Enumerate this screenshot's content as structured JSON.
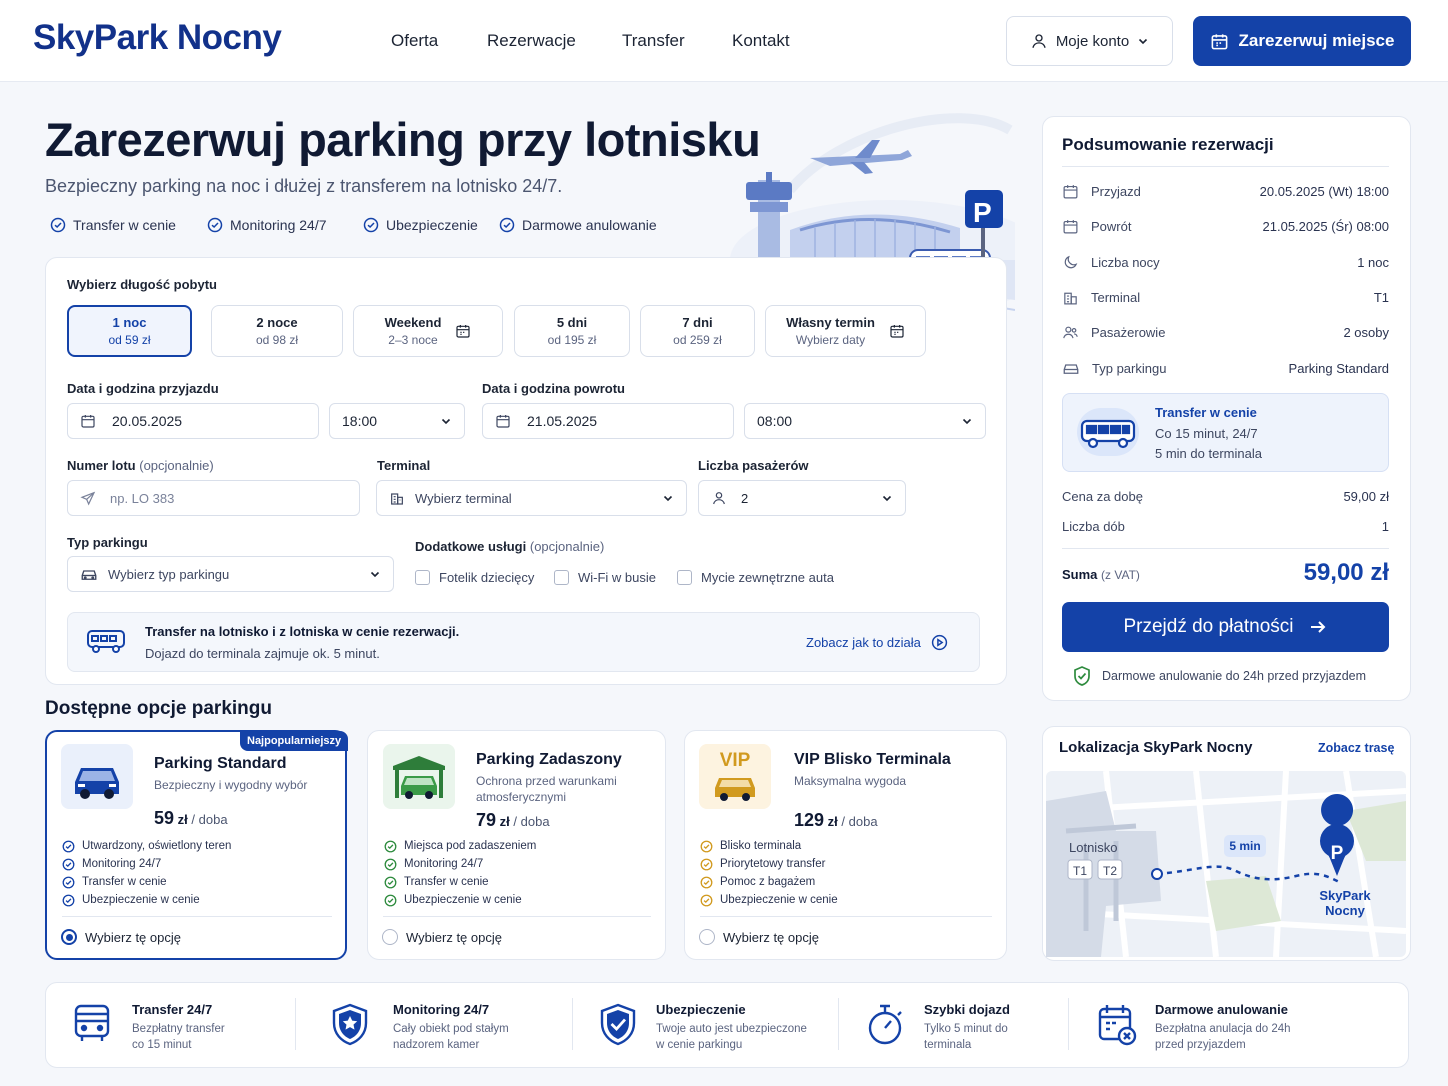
{
  "header": {
    "logo": "SkyPark Nocny",
    "nav": [
      "Oferta",
      "Rezerwacje",
      "Transfer",
      "Kontakt"
    ],
    "account_label": "Moje konto",
    "reserve_button": "Zarezerwuj miejsce"
  },
  "hero": {
    "title": "Zarezerwuj parking przy lotnisku",
    "subtitle": "Bezpieczny parking na noc i dłużej z transferem na lotnisko 24/7.",
    "features": [
      "Transfer w cenie",
      "Monitoring 24/7",
      "Ubezpieczenie",
      "Darmowe anulowanie"
    ],
    "parking_sign": "P"
  },
  "form": {
    "stay_label": "Wybierz długość pobytu",
    "stay_options": [
      {
        "title": "1 noc",
        "sub": "od 59 zł"
      },
      {
        "title": "2 noce",
        "sub": "od 98 zł"
      },
      {
        "title": "Weekend",
        "sub": "2–3 noce"
      },
      {
        "title": "5 dni",
        "sub": "od 195 zł"
      },
      {
        "title": "7 dni",
        "sub": "od 259 zł"
      },
      {
        "title": "Własny termin",
        "sub": "Wybierz daty"
      }
    ],
    "arrival_label": "Data i godzina przyjazdu",
    "arrival_date": "20.05.2025",
    "arrival_time": "18:00",
    "return_label": "Data i godzina powrotu",
    "return_date": "21.05.2025",
    "return_time": "08:00",
    "flight_label": "Numer lotu",
    "optional": "(opcjonalnie)",
    "flight_placeholder": "np. LO 383",
    "terminal_label": "Terminal",
    "terminal_placeholder": "Wybierz terminal",
    "passengers_label": "Liczba pasażerów",
    "passengers_value": "2",
    "parking_type_label": "Typ parkingu",
    "parking_type_placeholder": "Wybierz typ parkingu",
    "extras_label": "Dodatkowe usługi",
    "extras": [
      "Fotelik dziecięcy",
      "Wi-Fi w busie",
      "Mycie zewnętrzne auta"
    ],
    "transfer_title": "Transfer na lotnisko i z lotniska w cenie rezerwacji.",
    "transfer_sub": "Dojazd do terminala zajmuje ok. 5 minut.",
    "transfer_link": "Zobacz jak to działa"
  },
  "options": {
    "title": "Dostępne opcje parkingu",
    "cards": [
      {
        "badge": "Najpopularniejszy",
        "title": "Parking Standard",
        "sub": "Bezpieczny i wygodny wybór",
        "price": "59",
        "currency": "zł",
        "unit": "/ doba",
        "bullets": [
          "Utwardzony, oświetlony teren",
          "Monitoring 24/7",
          "Transfer w cenie",
          "Ubezpieczenie w cenie"
        ],
        "select": "Wybierz tę opcję"
      },
      {
        "title": "Parking Zadaszony",
        "sub": "Ochrona przed warunkami atmosferycznymi",
        "price": "79",
        "currency": "zł",
        "unit": "/ doba",
        "bullets": [
          "Miejsca pod zadaszeniem",
          "Monitoring 24/7",
          "Transfer w cenie",
          "Ubezpieczenie w cenie"
        ],
        "select": "Wybierz tę opcję"
      },
      {
        "icon_text": "VIP",
        "title": "VIP Blisko Terminala",
        "sub": "Maksymalna wygoda",
        "price": "129",
        "currency": "zł",
        "unit": "/ doba",
        "bullets": [
          "Blisko terminala",
          "Priorytetowy transfer",
          "Pomoc z bagażem",
          "Ubezpieczenie w cenie"
        ],
        "select": "Wybierz tę opcję"
      }
    ]
  },
  "summary": {
    "title": "Podsumowanie rezerwacji",
    "rows": [
      {
        "icon": "calendar-icon",
        "label": "Przyjazd",
        "value": "20.05.2025 (Wt) 18:00"
      },
      {
        "icon": "calendar-icon",
        "label": "Powrót",
        "value": "21.05.2025 (Śr) 08:00"
      },
      {
        "icon": "moon-icon",
        "label": "Liczba nocy",
        "value": "1 noc"
      },
      {
        "icon": "building-icon",
        "label": "Terminal",
        "value": "T1"
      },
      {
        "icon": "users-icon",
        "label": "Pasażerowie",
        "value": "2 osoby"
      },
      {
        "icon": "car-icon",
        "label": "Typ parkingu",
        "value": "Parking Standard"
      }
    ],
    "transfer_title": "Transfer w cenie",
    "transfer_line1": "Co 15 minut, 24/7",
    "transfer_line2": "5 min do terminala",
    "price_per_day_label": "Cena za dobę",
    "price_per_day": "59,00 zł",
    "days_label": "Liczba dób",
    "days": "1",
    "total_label": "Suma",
    "vat": "(z VAT)",
    "total": "59,00 zł",
    "pay_button": "Przejdź do płatności",
    "cancel_note": "Darmowe anulowanie do 24h przed przyjazdem"
  },
  "map": {
    "title": "Lokalizacja SkyPark Nocny",
    "route_link": "Zobacz trasę",
    "airport": "Lotnisko",
    "t1": "T1",
    "t2": "T2",
    "time": "5 min",
    "pin": "P",
    "place_line1": "SkyPark",
    "place_line2": "Nocny"
  },
  "bottom": [
    {
      "icon": "bus-icon",
      "title": "Transfer 24/7",
      "line1": "Bezpłatny transfer",
      "line2": "co 15 minut"
    },
    {
      "icon": "shield-star-icon",
      "title": "Monitoring 24/7",
      "line1": "Cały obiekt pod stałym",
      "line2": "nadzorem kamer"
    },
    {
      "icon": "shield-check-icon",
      "title": "Ubezpieczenie",
      "line1": "Twoje auto jest ubezpieczone",
      "line2": "w cenie parkingu"
    },
    {
      "icon": "stopwatch-icon",
      "title": "Szybki dojazd",
      "line1": "Tylko 5 minut do",
      "line2": "terminala"
    },
    {
      "icon": "calendar-x-icon",
      "title": "Darmowe anulowanie",
      "line1": "Bezpłatna anulacja do 24h",
      "line2": "przed przyjazdem"
    }
  ],
  "colors": {
    "primary": "#1442a8",
    "logo": "#12318a",
    "green": "#2e8b3e",
    "vip": "#d19a1f"
  }
}
